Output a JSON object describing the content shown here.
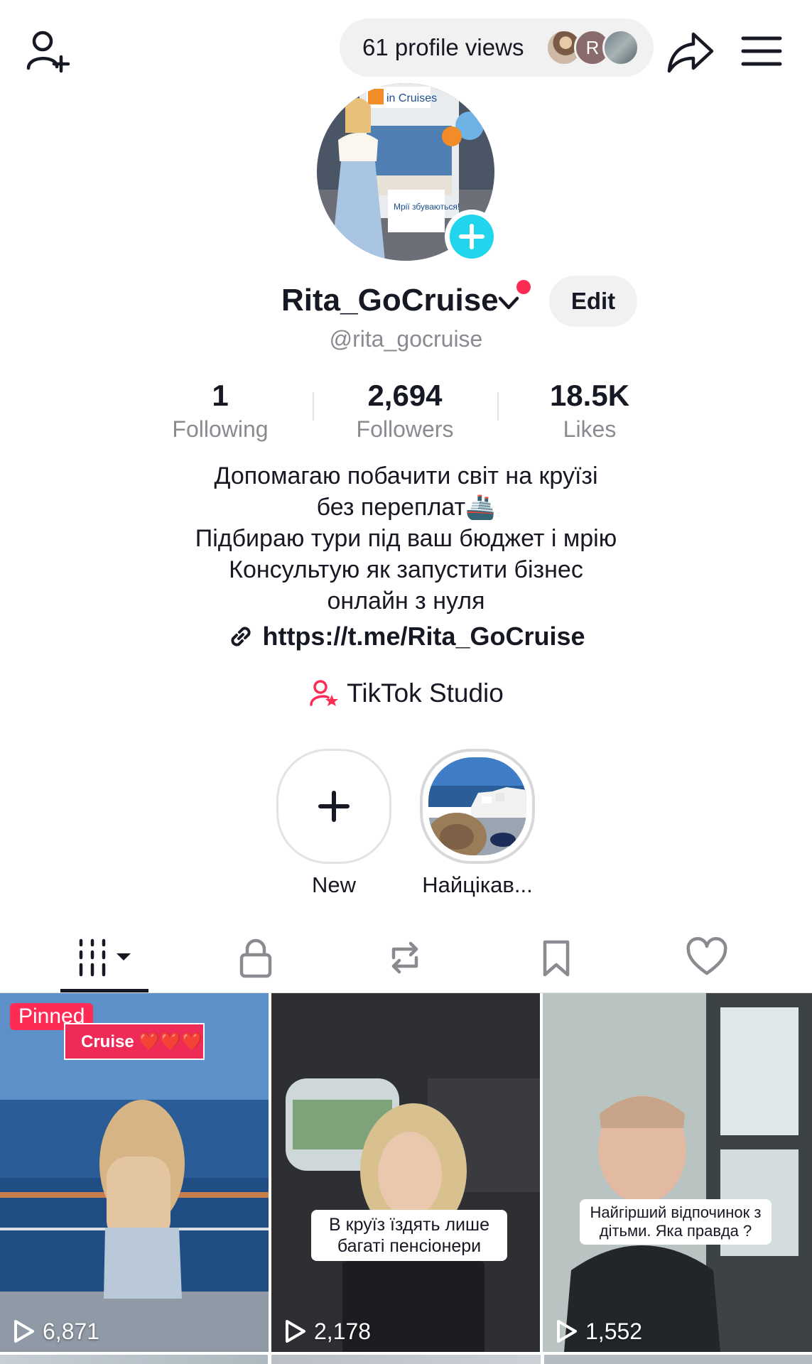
{
  "header": {
    "profile_views": "61 profile views",
    "viewer_initial": "R"
  },
  "profile": {
    "username": "Rita_GoCruise",
    "handle": "@rita_gocruise",
    "edit_label": "Edit",
    "avatar_sign_brand": "in Cruises",
    "avatar_sign_text": "Мрії збуваються!"
  },
  "stats": [
    {
      "value": "1",
      "label": "Following"
    },
    {
      "value": "2,694",
      "label": "Followers"
    },
    {
      "value": "18.5K",
      "label": "Likes"
    }
  ],
  "bio": {
    "lines": [
      "Допомагаю побачити світ на круїзі",
      "без переплат🚢",
      "Підбираю тури під ваш бюджет і мрію",
      "Консультую як запустити бізнес",
      "онлайн з нуля"
    ],
    "link": "https://t.me/Rita_GoCruise",
    "studio_label": "TikTok Studio"
  },
  "highlights": [
    {
      "label": "New"
    },
    {
      "label": "Найцікав..."
    }
  ],
  "tabs": [
    {
      "name": "videos",
      "icon": "grid-icon",
      "active": true
    },
    {
      "name": "private",
      "icon": "lock-icon"
    },
    {
      "name": "reposts",
      "icon": "repost-icon"
    },
    {
      "name": "favorites",
      "icon": "bookmark-icon"
    },
    {
      "name": "liked",
      "icon": "heart-icon"
    }
  ],
  "videos": [
    {
      "badge": "Pinned",
      "overlay_text": "Cruise ❤️❤️❤️",
      "views": "6,871"
    },
    {
      "caption": "В круїз їздять лише багаті пенсіонери",
      "views": "2,178"
    },
    {
      "caption": "Найгірший відпочинок з дітьми. Яка правда ?",
      "views": "1,552"
    }
  ],
  "colors": {
    "accent_red": "#fe2c55",
    "accent_cyan": "#20d5ec",
    "text_primary": "#161823",
    "text_secondary": "#8a8b91"
  }
}
